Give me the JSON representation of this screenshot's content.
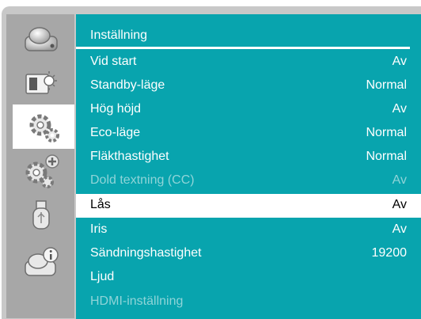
{
  "sidebar": {
    "tabs": [
      {
        "icon": "projector-icon",
        "selected": false
      },
      {
        "icon": "picture-brightness-icon",
        "selected": false
      },
      {
        "icon": "settings-gears-icon",
        "selected": true
      },
      {
        "icon": "advanced-settings-icon",
        "selected": false
      },
      {
        "icon": "usb-icon",
        "selected": false
      },
      {
        "icon": "information-icon",
        "selected": false
      }
    ]
  },
  "menu": {
    "title": "Inställning",
    "items": [
      {
        "label": "Vid start",
        "value": "Av",
        "state": "normal"
      },
      {
        "label": "Standby-läge",
        "value": "Normal",
        "state": "normal"
      },
      {
        "label": "Hög höjd",
        "value": "Av",
        "state": "normal"
      },
      {
        "label": "Eco-läge",
        "value": "Normal",
        "state": "normal"
      },
      {
        "label": "Fläkthastighet",
        "value": "Normal",
        "state": "normal"
      },
      {
        "label": "Dold textning (CC)",
        "value": "Av",
        "state": "disabled"
      },
      {
        "label": "Lås",
        "value": "Av",
        "state": "selected"
      },
      {
        "label": "Iris",
        "value": "Av",
        "state": "normal"
      },
      {
        "label": "Sändningshastighet",
        "value": "19200",
        "state": "normal"
      },
      {
        "label": "Ljud",
        "value": "",
        "state": "normal"
      },
      {
        "label": "HDMI-inställning",
        "value": "",
        "state": "disabled"
      }
    ]
  },
  "colors": {
    "accent": "#08a4ae",
    "sidebar": "#a7a7a7",
    "frame": "#c8c8c8",
    "disabled_text": "#8fd4d8"
  }
}
